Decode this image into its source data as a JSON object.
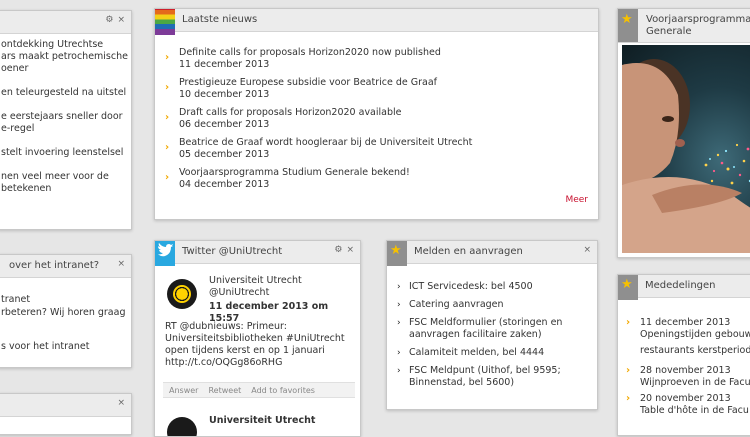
{
  "news_left": {
    "items": [
      "ontdekking Utrechtse",
      "ars maakt petrochemische",
      "oener",
      "en teleurgesteld na uitstel",
      "e eerstejaars sneller door",
      "e-regel",
      "stelt invoering leenstelsel",
      "nen veel meer voor de",
      "betekenen"
    ]
  },
  "intranet": {
    "title": "over het intranet?",
    "lines": [
      "tranet",
      "rbeteren? Wij horen graag",
      "s voor het intranet"
    ]
  },
  "latest_news": {
    "title": "Laatste nieuws",
    "items": [
      {
        "title": "Definite calls for proposals Horizon2020 now published",
        "date": "11 december 2013"
      },
      {
        "title": "Prestigieuze Europese subsidie voor Beatrice de Graaf",
        "date": "10 december 2013"
      },
      {
        "title": "Draft calls for proposals Horizon2020 available",
        "date": "06 december 2013"
      },
      {
        "title": "Beatrice de Graaf wordt hoogleraar bij de Universiteit Utrecht",
        "date": "05 december 2013"
      },
      {
        "title": "Voorjaarsprogramma Studium Generale bekend!",
        "date": "04 december 2013"
      }
    ],
    "more": "Meer"
  },
  "voorjaar": {
    "title_line1": "Voorjaarsprogramma",
    "title_line2": "Generale"
  },
  "twitter": {
    "title": "Twitter @UniUtrecht",
    "tweet": {
      "name": "Universiteit Utrecht",
      "handle": "@UniUtrecht",
      "date": "11 december 2013 om 15:57",
      "text": [
        "RT @dubnieuws: Primeur:",
        "Universiteitsbibliotheken #UniUtrecht",
        "open tijdens kerst en op 1 januari",
        "http://t.co/OQGg86oRHG"
      ],
      "actions": [
        "Answer",
        "Retweet",
        "Add to favorites"
      ]
    },
    "tweet2_name": "Universiteit Utrecht"
  },
  "melden": {
    "title": "Melden en aanvragen",
    "items": [
      [
        "ICT Servicedesk: bel 4500"
      ],
      [
        "Catering aanvragen"
      ],
      [
        "FSC Meldformulier (storingen en",
        "aanvragen facilitaire zaken)"
      ],
      [
        "Calamiteit melden, bel 4444"
      ],
      [
        "FSC Meldpunt (Uithof, bel 9595;",
        "Binnenstad, bel 5600)"
      ]
    ]
  },
  "mededelingen": {
    "title": "Mededelingen",
    "items": [
      {
        "date": "11 december 2013",
        "title": "Openingstijden gebouw"
      },
      {
        "date": "",
        "title": "restaurants kerstperiod"
      },
      {
        "date": "28 november 2013",
        "title": "Wijnproeven in de Facu"
      },
      {
        "date": "20 november 2013",
        "title": "Table d'hôte in de Facu"
      }
    ]
  },
  "icons": {
    "gear": "⚙",
    "close": "×",
    "star": "★",
    "arrow": "›",
    "bird": "bird-icon"
  },
  "colors": {
    "accent": "#f2a900",
    "twitter": "#29a8e0",
    "more": "#c8102e",
    "head": "#ececec"
  }
}
